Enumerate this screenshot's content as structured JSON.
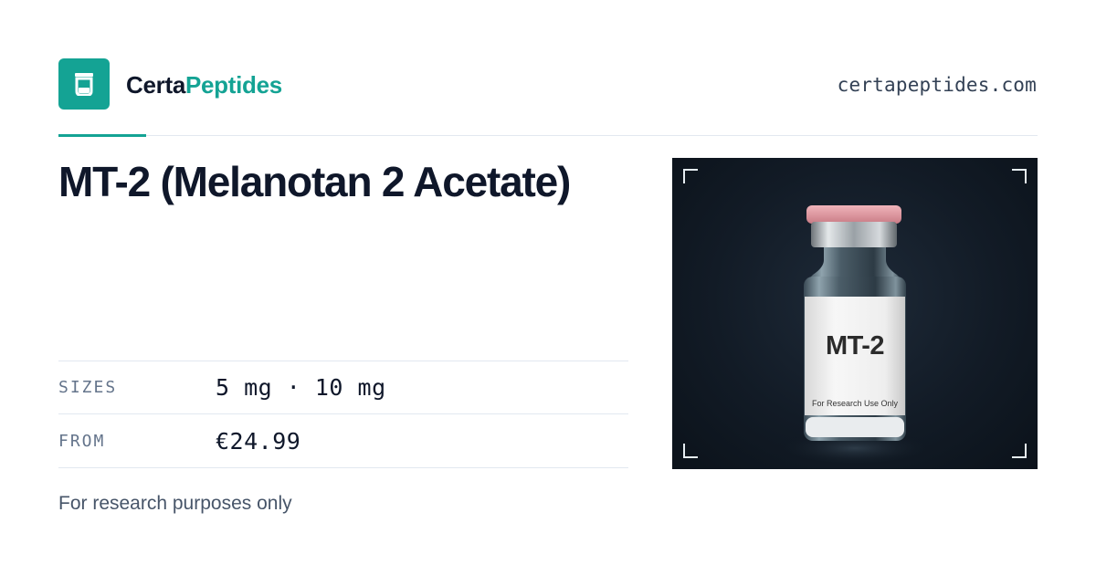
{
  "brand": {
    "name_part1": "Certa",
    "name_part2": "Peptides",
    "logo_icon": "cup-icon",
    "accent_color": "#14a394"
  },
  "site_url": "certapeptides.com",
  "product": {
    "title": "MT-2 (Melanotan 2 Acetate)",
    "specs": [
      {
        "label": "SIZES",
        "value": "5 mg · 10 mg"
      },
      {
        "label": "FROM",
        "value": "€24.99"
      }
    ],
    "disclaimer": "For research purposes only"
  },
  "image": {
    "label_main": "MT-2",
    "label_sub": "For Research Use Only",
    "cap_color": "#e6a1a8"
  }
}
